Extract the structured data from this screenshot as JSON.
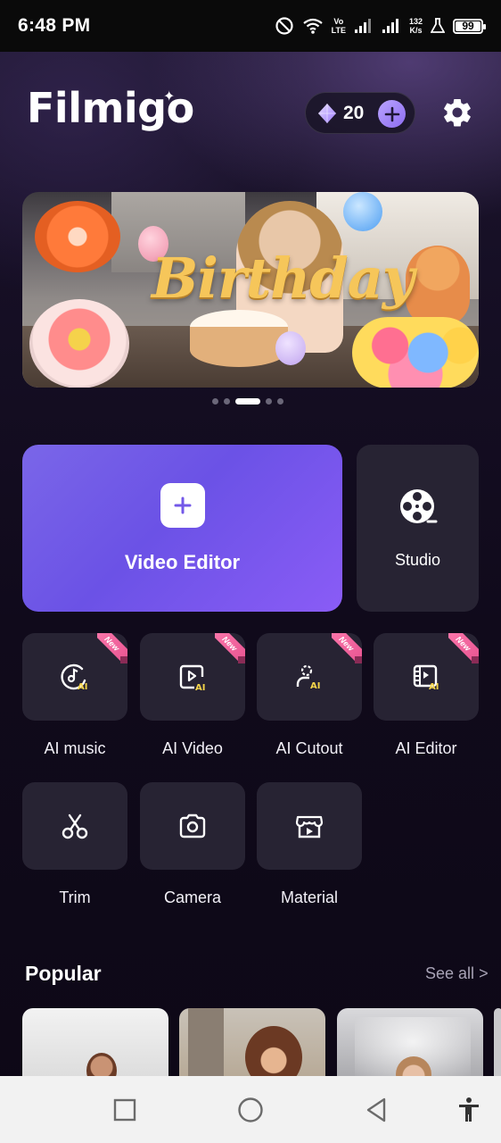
{
  "status_bar": {
    "time": "6:48 PM",
    "network_top": "Vo",
    "network_bottom": "LTE",
    "speed_top": "132",
    "speed_bottom": "K/s",
    "battery": "99",
    "battery_level": 0.99,
    "icons": [
      "do-not-disturb-icon",
      "wifi-icon",
      "signal-icon",
      "signal-icon",
      "flask-icon",
      "battery-icon"
    ]
  },
  "header": {
    "logo": "Filmigo",
    "credits": "20",
    "icons": [
      "gem-icon",
      "plus-icon",
      "gear-icon"
    ]
  },
  "banner": {
    "text": "Birthday",
    "slide_count": 5,
    "active_slide": 3
  },
  "main": {
    "video_editor_label": "Video Editor",
    "studio_label": "Studio"
  },
  "tools": [
    {
      "label": "AI music",
      "new": true,
      "badge": "New",
      "icon": "ai-music-icon"
    },
    {
      "label": "AI Video",
      "new": true,
      "badge": "New",
      "icon": "ai-video-icon"
    },
    {
      "label": "AI Cutout",
      "new": true,
      "badge": "New",
      "icon": "ai-cutout-icon"
    },
    {
      "label": "AI Editor",
      "new": true,
      "badge": "New",
      "icon": "ai-editor-icon"
    },
    {
      "label": "Trim",
      "new": false,
      "icon": "scissors-icon"
    },
    {
      "label": "Camera",
      "new": false,
      "icon": "camera-icon"
    },
    {
      "label": "Material",
      "new": false,
      "icon": "material-store-icon"
    }
  ],
  "popular": {
    "title": "Popular",
    "see_all": "See all"
  },
  "nav": {
    "icons": [
      "recents-icon",
      "home-icon",
      "back-icon",
      "accessibility-icon"
    ]
  },
  "colors": {
    "accent": "#7a66e8",
    "card": "#272333",
    "background": "#110b1d",
    "new_badge": "#e64f8e"
  }
}
